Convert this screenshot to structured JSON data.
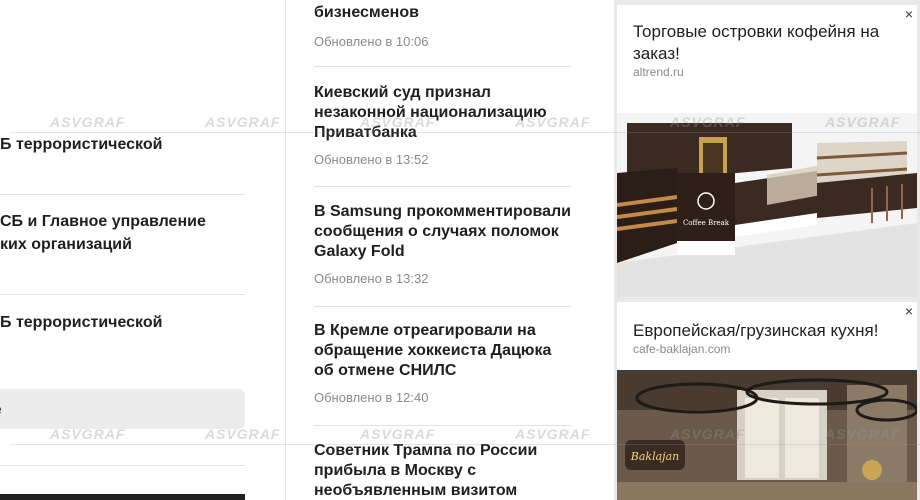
{
  "left": {
    "items": [
      "Б террористической",
      "СБ и Главное управление",
      "ких организаций",
      "Б террористической"
    ],
    "search_text": "е"
  },
  "news": [
    {
      "title": "бизнесменов",
      "time": "Обновлено в 10:06"
    },
    {
      "title": "Киевский суд признал незаконной национализацию Приватбанка",
      "time": "Обновлено в 13:52"
    },
    {
      "title": "В Samsung прокомментировали сообщения о случаях поломок Galaxy Fold",
      "time": "Обновлено в 13:32"
    },
    {
      "title": "В Кремле отреагировали на обращение хоккеиста Дацюка об отмене СНИЛС",
      "time": "Обновлено в 12:40"
    },
    {
      "title": "Советник Трампа по России прибыла в Москву с необъявленным визитом",
      "time": ""
    }
  ],
  "ads": [
    {
      "title": "Торговые островки кофейня на заказ!",
      "domain": "altrend.ru",
      "close": "×",
      "image": "coffee-kiosk-image",
      "sign": "Coffee Break"
    },
    {
      "title": "Европейская/грузинская кухня!",
      "domain": "cafe-baklajan.com",
      "close": "×",
      "image": "restaurant-interior-image",
      "sign": "Baklajan"
    }
  ],
  "watermark": "ASVGRAF",
  "colors": {
    "ad_background": "#e9e9e9",
    "text": "#1f1f1f",
    "muted": "#8a8a8a",
    "separator": "#e2e2e2"
  }
}
